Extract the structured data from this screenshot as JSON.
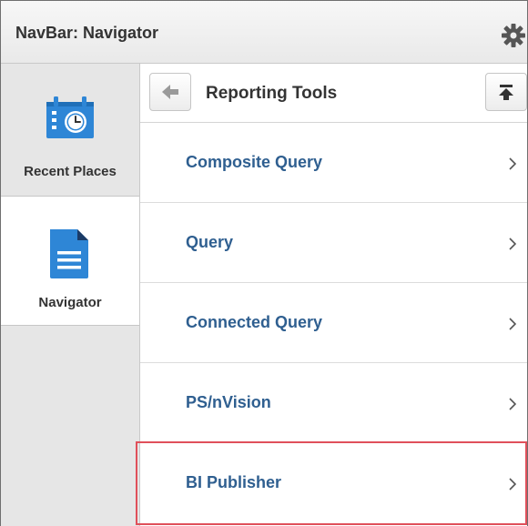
{
  "header": {
    "title": "NavBar: Navigator",
    "settings_icon": "gear-icon"
  },
  "sidebar": {
    "items": [
      {
        "label": "Recent Places",
        "icon": "calendar-clock-icon"
      },
      {
        "label": "Navigator",
        "icon": "document-icon",
        "selected": true
      }
    ]
  },
  "panel": {
    "title": "Reporting Tools",
    "back_icon": "back-arrow-icon",
    "top_icon": "return-to-top-icon",
    "items": [
      {
        "label": "Composite Query"
      },
      {
        "label": "Query"
      },
      {
        "label": "Connected Query"
      },
      {
        "label": "PS/nVision"
      },
      {
        "label": "BI Publisher",
        "highlighted": true
      }
    ]
  },
  "colors": {
    "link": "#2f5f90",
    "icon_blue": "#2e86d6",
    "highlight": "#e0505a"
  }
}
